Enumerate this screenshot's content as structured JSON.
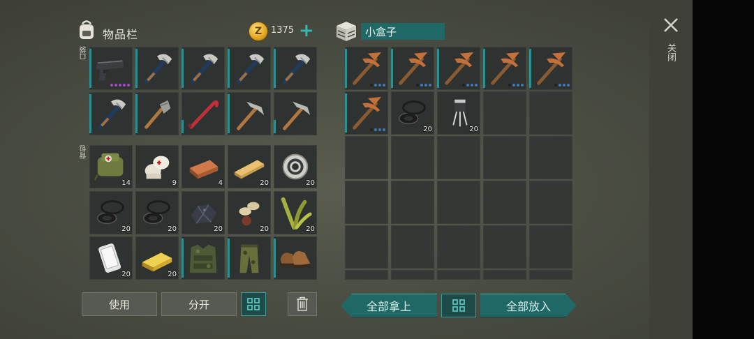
{
  "inventory": {
    "title": "物品栏",
    "gold": "1375",
    "pocket_label": "口袋",
    "backpack_label": "背包",
    "pocket": [
      {
        "icon": "pistol-icon",
        "dots": "purple"
      },
      {
        "icon": "hatchet-icon",
        "dots": ""
      },
      {
        "icon": "hatchet-icon",
        "dots": ""
      },
      {
        "icon": "hatchet-icon",
        "dots": ""
      },
      {
        "icon": "hatchet-icon",
        "dots": ""
      },
      {
        "icon": "hatchet-icon",
        "dots": ""
      },
      {
        "icon": "shovel-icon",
        "dots": ""
      },
      {
        "icon": "crowbar-icon",
        "dots": ""
      },
      {
        "icon": "pickaxe-icon",
        "dots": ""
      },
      {
        "icon": "pickaxe-icon",
        "dots": ""
      }
    ],
    "backpack": [
      {
        "icon": "first-aid-bag-icon",
        "count": "14"
      },
      {
        "icon": "bandage-icon",
        "count": "9"
      },
      {
        "icon": "copper-ingot-icon",
        "count": "4"
      },
      {
        "icon": "wood-plank-icon",
        "count": "20"
      },
      {
        "icon": "bearing-icon",
        "count": "20"
      },
      {
        "icon": "rubber-seal-icon",
        "count": "20"
      },
      {
        "icon": "rubber-seal-icon",
        "count": "20"
      },
      {
        "icon": "coal-ore-icon",
        "count": "20"
      },
      {
        "icon": "seeds-icon",
        "count": "20"
      },
      {
        "icon": "plant-fiber-icon",
        "count": "20"
      },
      {
        "icon": "smartphone-icon",
        "count": "20"
      },
      {
        "icon": "gold-ingot-icon",
        "count": "20"
      },
      {
        "icon": "camo-vest-icon",
        "count": ""
      },
      {
        "icon": "camo-pants-icon",
        "count": ""
      },
      {
        "icon": "boots-icon",
        "count": ""
      }
    ],
    "use_label": "使用",
    "split_label": "分开"
  },
  "box": {
    "title": "小盒子",
    "items": [
      {
        "icon": "copper-pickaxe-icon",
        "count": "",
        "dots": "blue"
      },
      {
        "icon": "copper-pickaxe-icon",
        "count": "",
        "dots": "blue"
      },
      {
        "icon": "copper-pickaxe-icon",
        "count": "",
        "dots": "blue"
      },
      {
        "icon": "copper-pickaxe-icon",
        "count": "",
        "dots": "blue"
      },
      {
        "icon": "copper-pickaxe-icon",
        "count": "",
        "dots": "blue"
      },
      {
        "icon": "copper-pickaxe-icon",
        "count": "",
        "dots": "blue"
      },
      {
        "icon": "rubber-seal-icon",
        "count": "20",
        "dots": ""
      },
      {
        "icon": "transistor-icon",
        "count": "20",
        "dots": ""
      }
    ],
    "take_all_label": "全部拿上",
    "put_all_label": "全部放入"
  },
  "close_label": "关闭",
  "colors": {
    "accent": "#2f8e92",
    "button_teal": "#1f6866",
    "gold": "#e0a520"
  }
}
